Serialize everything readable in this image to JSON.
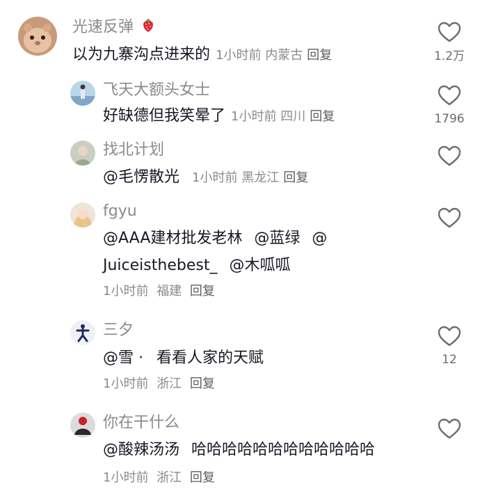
{
  "comments": [
    {
      "username": "光速反弹",
      "username_emoji": "strawberry-icon",
      "text": "以为九寨沟点进来的",
      "time": "1小时前",
      "location": "内蒙古",
      "reply": "回复",
      "likes": "1.2万"
    },
    {
      "username": "飞天大额头女士",
      "text": "好缺德但我笑晕了",
      "time": "1小时前",
      "location": "四川",
      "reply": "回复",
      "likes": "1796"
    },
    {
      "username": "找北计划",
      "mention": "@毛愣散光",
      "time": "1小时前",
      "location": "黑龙江",
      "reply": "回复",
      "likes": ""
    },
    {
      "username": "fgyu",
      "line1_m1": "@AAA建材批发老林",
      "line1_m2": "@蓝绿",
      "line1_m3": "@",
      "line2_m1": "Juiceisthebest_",
      "line2_m2": "@木呱呱",
      "time": "1小时前",
      "location": "福建",
      "reply": "回复",
      "likes": ""
    },
    {
      "username": "三夕",
      "mention": "@雪 ·",
      "text": "看看人家的天赋",
      "time": "1小时前",
      "location": "浙江",
      "reply": "回复",
      "likes": "12"
    },
    {
      "username": "你在干什么",
      "mention": "@酸辣汤汤",
      "text": "哈哈哈哈哈哈哈哈哈哈哈哈",
      "time": "1小时前",
      "location": "浙江",
      "reply": "回复",
      "likes": ""
    }
  ],
  "colors": {
    "text": "#161823",
    "secondary": "#8a8a8f",
    "icon": "#6b6b72"
  }
}
